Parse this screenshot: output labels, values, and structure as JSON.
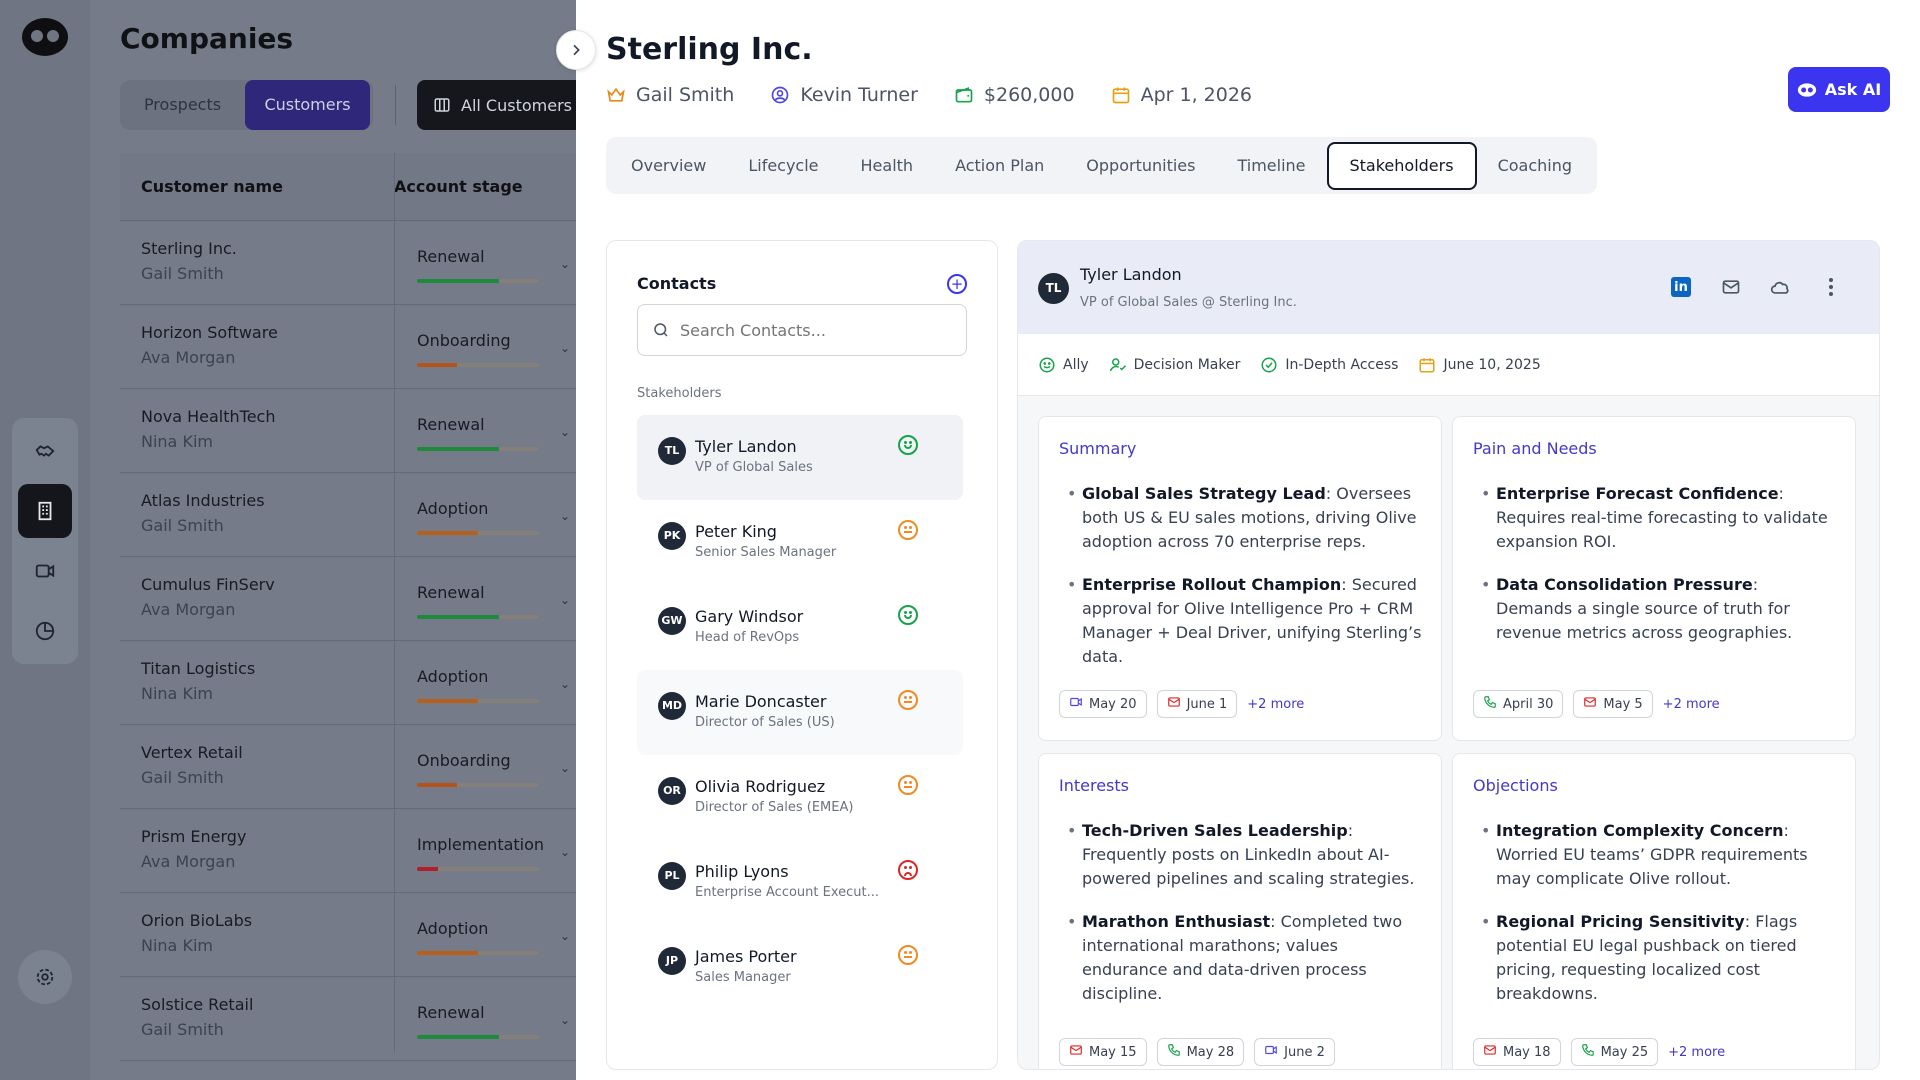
{
  "sidebar": {
    "nav_icons": [
      "handshake-icon",
      "building-icon",
      "video-icon",
      "pie-chart-icon"
    ],
    "active_index": 1,
    "settings_icon": "gear-icon"
  },
  "companies": {
    "title": "Companies",
    "segments": [
      "Prospects",
      "Customers"
    ],
    "active_segment": "Customers",
    "view_button": "All Customers",
    "columns": [
      "Customer name",
      "Account stage"
    ],
    "rows": [
      {
        "name": "Sterling Inc.",
        "owner": "Gail Smith",
        "stage": "Renewal",
        "progress": 0.67,
        "color": "#1e8a3b"
      },
      {
        "name": "Horizon Software",
        "owner": "Ava Morgan",
        "stage": "Onboarding",
        "progress": 0.33,
        "color": "#b4531a"
      },
      {
        "name": "Nova HealthTech",
        "owner": "Nina Kim",
        "stage": "Renewal",
        "progress": 0.67,
        "color": "#1e8a3b"
      },
      {
        "name": "Atlas Industries",
        "owner": "Gail Smith",
        "stage": "Adoption",
        "progress": 0.5,
        "color": "#b6601c"
      },
      {
        "name": "Cumulus FinServ",
        "owner": "Ava Morgan",
        "stage": "Renewal",
        "progress": 0.67,
        "color": "#1e8a3b"
      },
      {
        "name": "Titan Logistics",
        "owner": "Nina Kim",
        "stage": "Adoption",
        "progress": 0.5,
        "color": "#b6601c"
      },
      {
        "name": "Vertex Retail",
        "owner": "Gail Smith",
        "stage": "Onboarding",
        "progress": 0.33,
        "color": "#b4531a"
      },
      {
        "name": "Prism Energy",
        "owner": "Ava Morgan",
        "stage": "Implementation",
        "progress": 0.17,
        "color": "#b01f2a"
      },
      {
        "name": "Orion BioLabs",
        "owner": "Nina Kim",
        "stage": "Adoption",
        "progress": 0.5,
        "color": "#b6601c"
      },
      {
        "name": "Solstice Retail",
        "owner": "Gail Smith",
        "stage": "Renewal",
        "progress": 0.67,
        "color": "#1e8a3b"
      }
    ]
  },
  "drawer": {
    "title": "Sterling Inc.",
    "owner": "Gail Smith",
    "csm": "Kevin Turner",
    "value": "$260,000",
    "date": "Apr 1, 2026",
    "ask_ai": "Ask AI",
    "tabs": [
      "Overview",
      "Lifecycle",
      "Health",
      "Action Plan",
      "Opportunities",
      "Timeline",
      "Stakeholders",
      "Coaching"
    ],
    "active_tab": "Stakeholders"
  },
  "contacts": {
    "heading": "Contacts",
    "search_placeholder": "Search Contacts...",
    "section_label": "Stakeholders",
    "items": [
      {
        "initials": "TL",
        "name": "Tyler Landon",
        "role": "VP of Global Sales",
        "sentiment": "happy"
      },
      {
        "initials": "PK",
        "name": "Peter King",
        "role": "Senior Sales Manager",
        "sentiment": "neutral"
      },
      {
        "initials": "GW",
        "name": "Gary Windsor",
        "role": "Head of RevOps",
        "sentiment": "happy"
      },
      {
        "initials": "MD",
        "name": "Marie Doncaster",
        "role": "Director of Sales (US)",
        "sentiment": "neutral"
      },
      {
        "initials": "OR",
        "name": "Olivia Rodriguez",
        "role": "Director of Sales (EMEA)",
        "sentiment": "neutral"
      },
      {
        "initials": "PL",
        "name": "Philip Lyons",
        "role": "Enterprise Account Execut...",
        "sentiment": "sad"
      },
      {
        "initials": "JP",
        "name": "James Porter",
        "role": "Sales Manager",
        "sentiment": "neutral"
      }
    ]
  },
  "profile": {
    "initials": "TL",
    "name": "Tyler Landon",
    "title": "VP of Global Sales @ Sterling Inc.",
    "badges": [
      "Ally",
      "Decision Maker",
      "In-Depth Access",
      "June 10, 2025"
    ],
    "cards": [
      {
        "heading": "Summary",
        "bullets": [
          {
            "b": "Global Sales Strategy Lead",
            "t": ": Oversees both US & EU sales motions, driving Olive adoption across 70 enterprise reps."
          },
          {
            "b": "Enterprise Rollout Champion",
            "t": ": Secured approval for Olive Intelligence Pro + CRM Manager + Deal Driver, unifying Sterling’s data."
          }
        ],
        "chips": [
          {
            "icon": "video",
            "label": "May 20"
          },
          {
            "icon": "mail",
            "label": "June 1"
          }
        ],
        "more": "+2 more"
      },
      {
        "heading": "Pain and Needs",
        "bullets": [
          {
            "b": "Enterprise Forecast Confidence",
            "t": ": Requires real-time forecasting to validate expansion ROI."
          },
          {
            "b": "Data Consolidation Pressure",
            "t": ": Demands a single source of truth for revenue metrics across geographies."
          }
        ],
        "chips": [
          {
            "icon": "phone",
            "label": "April 30"
          },
          {
            "icon": "mail",
            "label": "May 5"
          }
        ],
        "more": "+2 more"
      },
      {
        "heading": "Interests",
        "bullets": [
          {
            "b": "Tech-Driven Sales Leadership",
            "t": ": Frequently posts on LinkedIn about AI-powered pipelines and scaling strategies."
          },
          {
            "b": "Marathon Enthusiast",
            "t": ": Completed two international marathons; values endurance and data-driven process discipline."
          }
        ],
        "chips": [
          {
            "icon": "mail",
            "label": "May 15"
          },
          {
            "icon": "phone",
            "label": "May 28"
          },
          {
            "icon": "video",
            "label": "June 2"
          }
        ],
        "more": ""
      },
      {
        "heading": "Objections",
        "bullets": [
          {
            "b": "Integration Complexity Concern",
            "t": ": Worried EU teams’ GDPR requirements may complicate Olive rollout."
          },
          {
            "b": "Regional Pricing Sensitivity",
            "t": ": Flags potential EU legal pushback on tiered pricing, requesting localized cost breakdowns."
          }
        ],
        "chips": [
          {
            "icon": "mail",
            "label": "May 18"
          },
          {
            "icon": "phone",
            "label": "May 25"
          }
        ],
        "more": "+2 more"
      }
    ]
  }
}
